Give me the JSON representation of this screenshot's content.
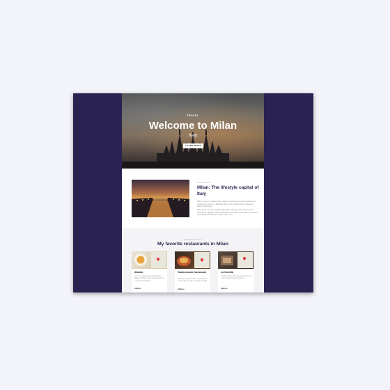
{
  "hero": {
    "tag": "TRAVEL",
    "title": "Welcome to Milan",
    "subtitle": "Italy",
    "cta": "LEARN MORE"
  },
  "article": {
    "kicker": "LIFESTYLE",
    "title": "Milan: The lifestyle capital of Italy",
    "paragraph_1": "Milan is a city in northern Italy, capital of Lombardy, and the second-most populous city proper in Italy after Rome. It is a global center of fashion, design and finance.",
    "paragraph_2": "Milan hosts one of the largest trade fairs in Europe and is known for its restaurants, nightlife, historic landmarks and vibrant cultural life. The Duomo and Navigli canals attract visitors year round."
  },
  "restaurants": {
    "kicker": "RESTAURANTS",
    "title": "My favorite restaurants in Milan",
    "items": [
      {
        "name": "Alkatto",
        "description": "A cozy restaurant serving traditional Milanese dishes with a modern twist and a relaxed atmosphere.",
        "address": "Address"
      },
      {
        "name": "Gastronomia Yamamoto",
        "description": "Authentic Japanese home cooking in the heart of the city with fresh daily specials.",
        "address": "Address"
      },
      {
        "name": "La Società",
        "description": "A refined bistro with seasonal menus and a warm welcoming dining room.",
        "address": "Address"
      }
    ]
  },
  "colors": {
    "frame": "#2a2250",
    "heading": "#2a2250",
    "map_pin": "#e03131"
  }
}
